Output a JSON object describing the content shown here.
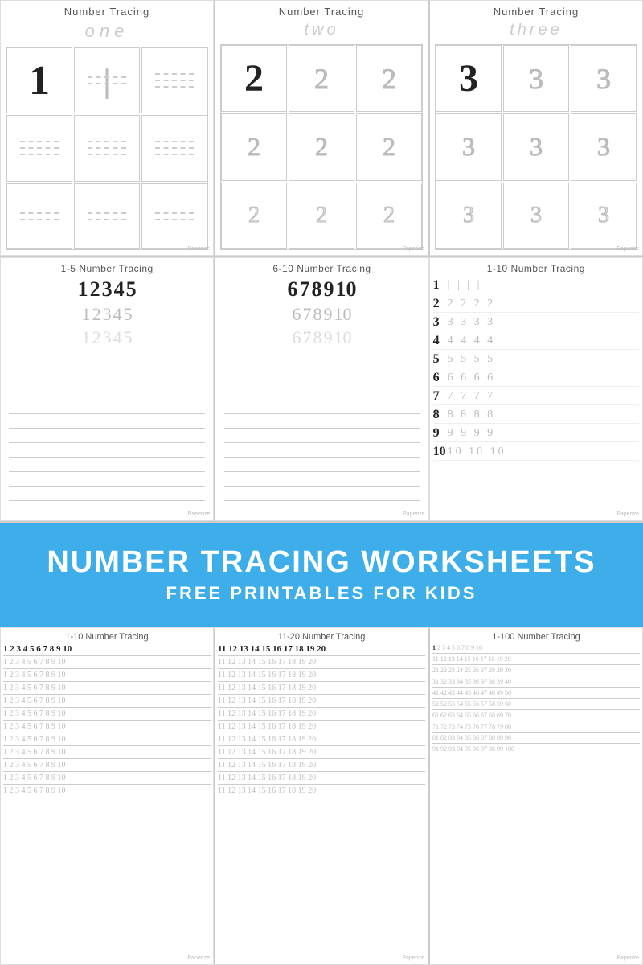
{
  "top": {
    "cards": [
      {
        "title": "Number Tracing",
        "subtitle": "one",
        "number": "1",
        "type": "single"
      },
      {
        "title": "Number Tracing",
        "subtitle": "two",
        "number": "2",
        "type": "single"
      },
      {
        "title": "Number Tracing",
        "subtitle": "three",
        "number": "3",
        "type": "single"
      }
    ]
  },
  "middle": {
    "cards": [
      {
        "title": "1-5 Number Tracing",
        "rows": [
          {
            "bold": "1 2 3 4 5",
            "dashed": false
          },
          {
            "bold": "1 2 3 4 5",
            "dashed": true
          },
          {
            "bold": "1 2 3 4 5",
            "dashed": true
          }
        ]
      },
      {
        "title": "6-10 Number Tracing",
        "rows": [
          {
            "bold": "6 7 8 9 10",
            "dashed": false
          },
          {
            "bold": "6 7 8 9 10",
            "dashed": true
          },
          {
            "bold": "6 7 8 9 10",
            "dashed": true
          }
        ]
      },
      {
        "title": "1-10 Number Tracing",
        "numberRows": [
          {
            "num": "1",
            "trace": "| | | |"
          },
          {
            "num": "2",
            "trace": "2 2 2 2"
          },
          {
            "num": "3",
            "trace": "3 3 3 3"
          },
          {
            "num": "4",
            "trace": "4 4 4 4"
          },
          {
            "num": "5",
            "trace": "5 5 5 5"
          },
          {
            "num": "6",
            "trace": "6 6 6 6"
          },
          {
            "num": "7",
            "trace": "7 7 7 7"
          },
          {
            "num": "8",
            "trace": "8 8 8 8"
          },
          {
            "num": "9",
            "trace": "9 9 9 9"
          },
          {
            "num": "10",
            "trace": "10 10 10"
          }
        ]
      }
    ]
  },
  "banner": {
    "title": "NUMBER TRACING WORKSHEETS",
    "subtitle": "FREE PRINTABLES FOR KIDS"
  },
  "bottom": {
    "cards": [
      {
        "title": "1-10 Number Tracing",
        "rows": [
          "1 2 3 4 5 6 7 8 9 10",
          "1 2 3 4 5 6 7 8 9 10",
          "1 2 3 4 5 6 7 8 9 10",
          "1 2 3 4 5 6 7 8 9 10",
          "1 2 3 4 5 6 7 8 9 10",
          "1 2 3 4 5 6 7 8 9 10",
          "1 2 3 4 5 6 7 8 9 10",
          "1 2 3 4 5 6 7 8 9 10",
          "1 2 3 4 5 6 7 8 9 10",
          "1 2 3 4 5 6 7 8 9 10",
          "1 2 3 4 5 6 7 8 9 10",
          "1 2 3 4 5 6 7 8 9 10"
        ]
      },
      {
        "title": "11-20 Number Tracing",
        "rows": [
          "11 12 13 14 15 16 17 18 19 20",
          "11 12 13 14 15 16 17 18 19 20",
          "11 12 13 14 15 16 17 18 19 20",
          "11 12 13 14 15 16 17 18 19 20",
          "11 12 13 14 15 16 17 18 19 20",
          "11 12 13 14 15 16 17 18 19 20",
          "11 12 13 14 15 16 17 18 19 20",
          "11 12 13 14 15 16 17 18 19 20",
          "11 12 13 14 15 16 17 18 19 20",
          "11 12 13 14 15 16 17 18 19 20",
          "11 12 13 14 15 16 17 18 19 20",
          "11 12 13 14 15 16 17 18 19 20"
        ]
      },
      {
        "title": "1-100 Number Tracing",
        "hundredRows": [
          "1  2  3  4  5  6  7  8  9  10",
          "11 12 13 14 15 16 17 18 19 20",
          "21 22 23 24 25 26 27 28 29 30",
          "31 32 33 34 35 36 37 38 39 40",
          "41 42 43 44 45 46 47 48 49 50",
          "51 52 53 54 55 56 57 58 59 60",
          "61 62 63 64 65 66 67 68 69 70",
          "71 72 73 74 75 76 77 78 79 80",
          "81 82 83 84 85 86 87 88 89 90",
          "91 92 93 94 95 96 97 98 99 100"
        ]
      }
    ]
  }
}
